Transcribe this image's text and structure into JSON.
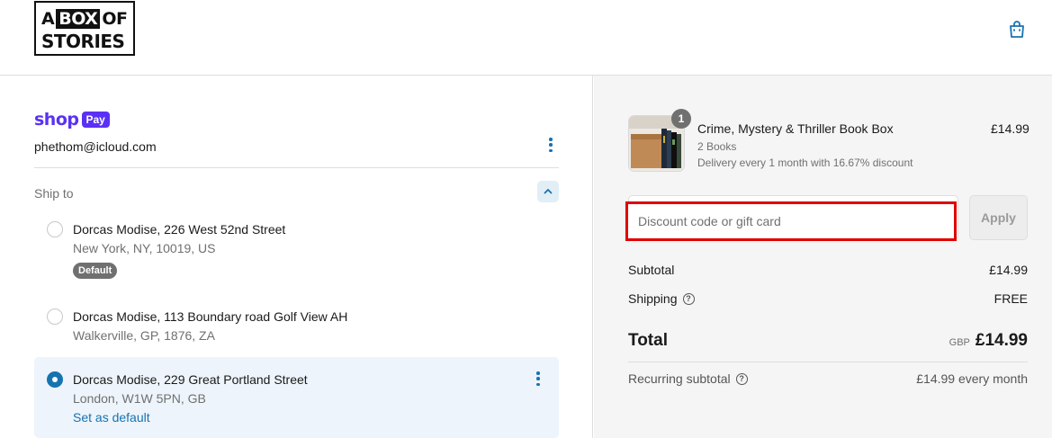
{
  "header": {
    "logo": {
      "row1_a": "A",
      "row1_box": "BOX",
      "row1_of": "OF",
      "row2": "STORIES"
    },
    "cart_icon": "shopping-bag-icon"
  },
  "account": {
    "brand_shop": "shop",
    "brand_pay": "Pay",
    "email": "phethom@icloud.com",
    "menu_icon": "kebab-menu-icon"
  },
  "shipping": {
    "heading": "Ship to",
    "collapse_icon": "chevron-up-icon",
    "addresses": [
      {
        "line1": "Dorcas Modise, 226 West 52nd Street",
        "line2": "New York, NY, 10019, US",
        "badge": "Default",
        "selected": false
      },
      {
        "line1": "Dorcas Modise, 113 Boundary road Golf View AH",
        "line2": "Walkerville, GP, 1876, ZA",
        "selected": false
      },
      {
        "line1": "Dorcas Modise, 229 Great Portland Street",
        "line2": "London, W1W 5PN, GB",
        "action": "Set as default",
        "selected": true
      }
    ]
  },
  "order": {
    "item": {
      "quantity": "1",
      "title": "Crime, Mystery & Thriller Book Box",
      "detail": "2 Books",
      "delivery": "Delivery every 1 month with 16.67% discount",
      "price": "£14.99"
    },
    "discount": {
      "placeholder": "Discount code or gift card",
      "value": "",
      "button": "Apply"
    },
    "subtotal": {
      "label": "Subtotal",
      "value": "£14.99"
    },
    "shipping": {
      "label": "Shipping",
      "value": "FREE"
    },
    "total": {
      "label": "Total",
      "currency": "GBP",
      "value": "£14.99"
    },
    "recurring": {
      "label": "Recurring subtotal",
      "value": "£14.99 every month"
    }
  },
  "colors": {
    "shop_pay_purple": "#5a31f4",
    "link_blue": "#1773b0",
    "highlight_red": "#e00000",
    "summary_bg": "#f5f5f5"
  }
}
